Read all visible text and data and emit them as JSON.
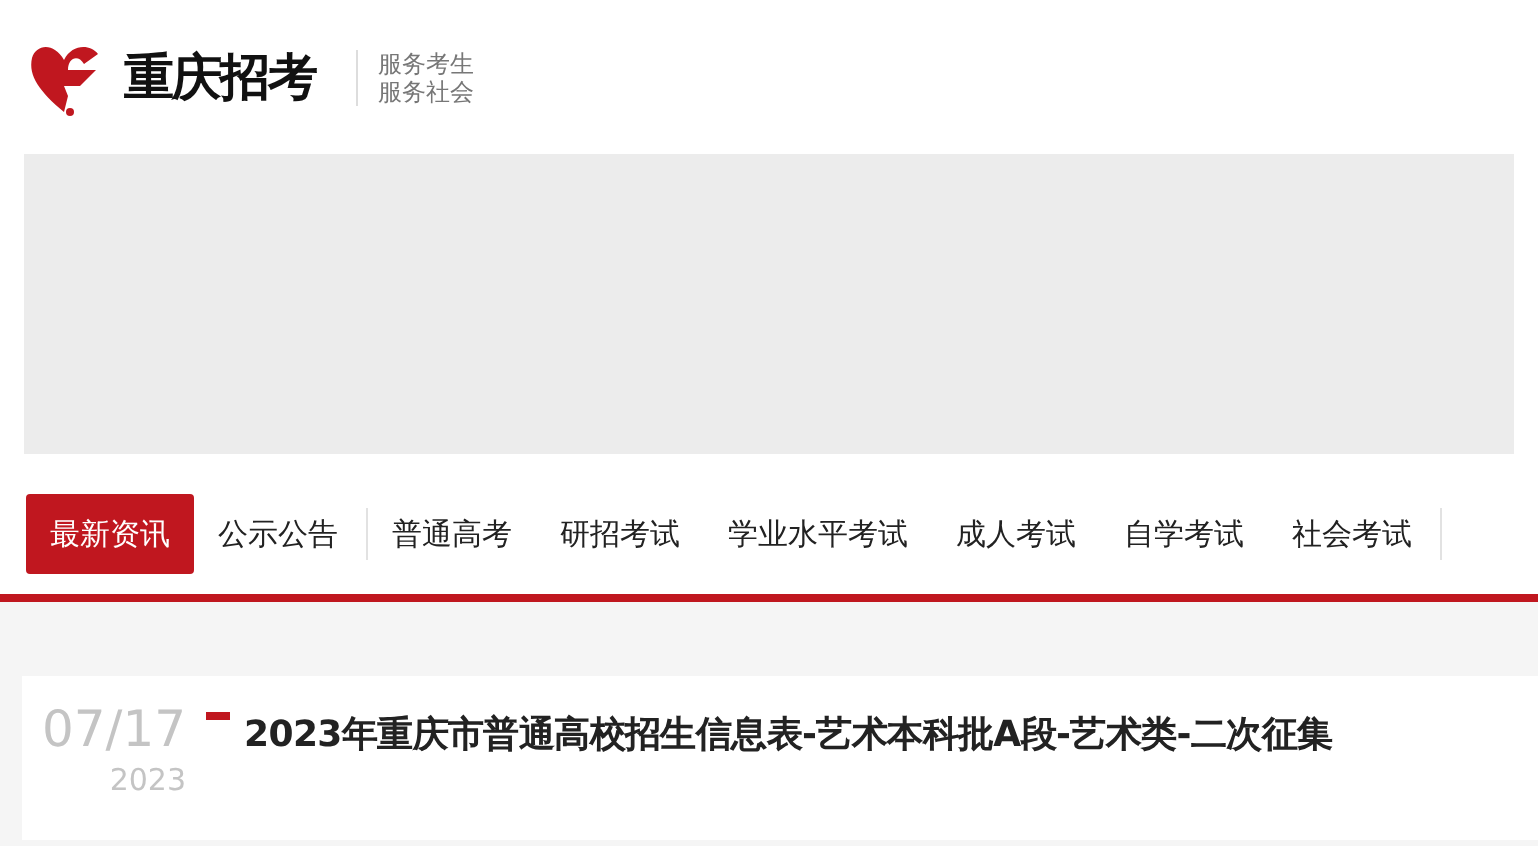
{
  "logo": {
    "name": "重庆招考",
    "slogans": [
      "服务考生",
      "服务社会"
    ]
  },
  "banner": {
    "kind": "blank"
  },
  "tabs": [
    {
      "label": "最新资讯",
      "selected": true,
      "divider_after": false
    },
    {
      "label": "公示公告",
      "selected": false,
      "divider_after": true
    },
    {
      "label": "普通高考",
      "selected": false,
      "divider_after": false
    },
    {
      "label": "研招考试",
      "selected": false,
      "divider_after": false
    },
    {
      "label": "学业水平考试",
      "selected": false,
      "divider_after": false
    },
    {
      "label": "成人考试",
      "selected": false,
      "divider_after": false
    },
    {
      "label": "自学考试",
      "selected": false,
      "divider_after": false
    },
    {
      "label": "社会考试",
      "selected": false,
      "divider_after": true
    }
  ],
  "news": [
    {
      "date": "07/17",
      "year": "2023",
      "title": "2023年重庆市普通高校招生信息表-艺术本科批A段-艺术类-二次征集"
    }
  ]
}
